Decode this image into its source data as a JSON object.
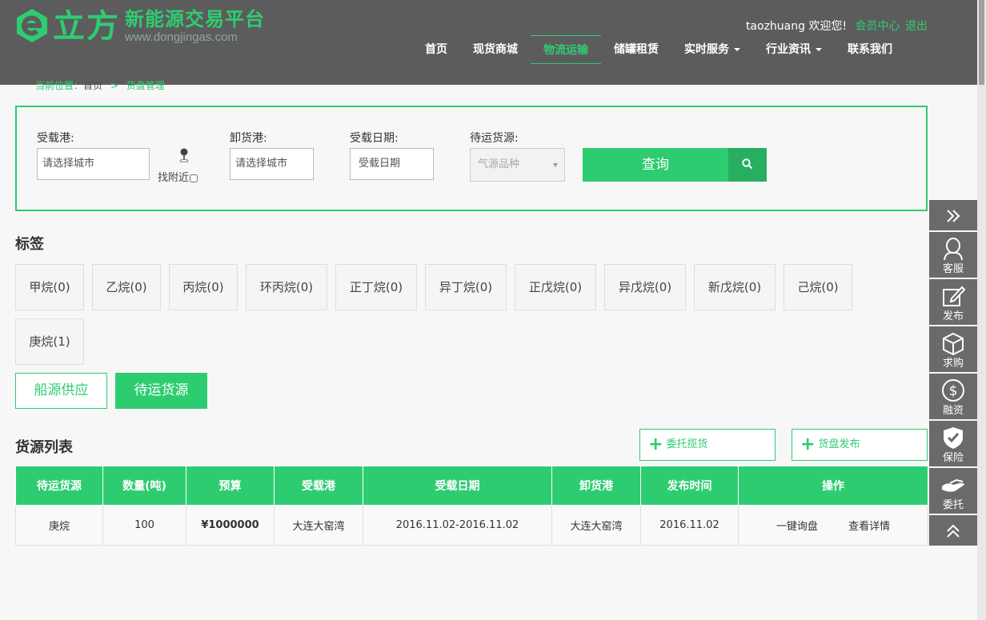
{
  "brand": {
    "logo_text": "立方",
    "tagline": "新能源交易平台",
    "url": "www.dongjingas.com"
  },
  "user_bar": {
    "username": "taozhuang",
    "welcome": "欢迎您!",
    "member_center": "会员中心",
    "logout": "退出"
  },
  "nav": {
    "items": [
      {
        "label": "首页"
      },
      {
        "label": "现货商城"
      },
      {
        "label": "物流运输"
      },
      {
        "label": "储罐租赁"
      },
      {
        "label": "实时服务"
      },
      {
        "label": "行业资讯"
      },
      {
        "label": "联系我们"
      }
    ],
    "active": "物流运输"
  },
  "breadcrumb": {
    "prefix": "当前位置：",
    "home": "首页",
    "sep": ">",
    "current": "货盘管理"
  },
  "search": {
    "load_port_label": "受载港:",
    "load_port_placeholder": "请选择城市",
    "nearby_label": "找附近",
    "discharge_port_label": "卸货港:",
    "discharge_port_placeholder": "请选择城市",
    "load_date_label": "受载日期:",
    "load_date_placeholder": "受载日期",
    "cargo_label": "待运货源:",
    "cargo_select": "气源品种",
    "query_button": "查询"
  },
  "tags": {
    "title": "标签",
    "items": [
      {
        "label": "甲烷(0)"
      },
      {
        "label": "乙烷(0)"
      },
      {
        "label": "丙烷(0)"
      },
      {
        "label": "环丙烷(0)"
      },
      {
        "label": "正丁烷(0)"
      },
      {
        "label": "异丁烷(0)"
      },
      {
        "label": "正戊烷(0)"
      },
      {
        "label": "异戊烷(0)"
      },
      {
        "label": "新戊烷(0)"
      },
      {
        "label": "己烷(0)"
      },
      {
        "label": "庚烷(1)"
      }
    ]
  },
  "toggles": {
    "ship_supply": "船源供应",
    "cargo_pending": "待运货源"
  },
  "list": {
    "title": "货源列表",
    "entrust_button": "委托揽货",
    "publish_button": "货盘发布",
    "columns": [
      "待运货源",
      "数量(吨)",
      "预算",
      "受载港",
      "受载日期",
      "卸货港",
      "发布时间",
      "操作"
    ],
    "rows": [
      {
        "cargo": "庚烷",
        "quantity": "100",
        "budget": "¥1000000",
        "load_port": "大连大窑湾",
        "load_date": "2016.11.02-2016.11.02",
        "discharge_port": "大连大窑湾",
        "publish_time": "2016.11.02",
        "action_inquiry": "一键询盘",
        "action_detail": "查看详情"
      }
    ]
  },
  "sidebar": {
    "items": [
      {
        "label": "客服"
      },
      {
        "label": "发布"
      },
      {
        "label": "求购"
      },
      {
        "label": "融资"
      },
      {
        "label": "保险"
      },
      {
        "label": "委托"
      }
    ]
  },
  "colors": {
    "accent": "#2ecc71",
    "header_bg": "#5c5c5c",
    "sidebar_bg": "#6a6a6a"
  }
}
